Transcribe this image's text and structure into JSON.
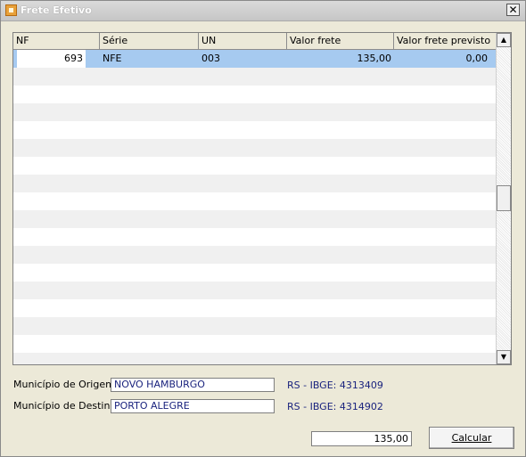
{
  "window": {
    "title": "Frete Efetivo",
    "close_symbol": "✕"
  },
  "grid": {
    "columns": [
      "NF",
      "Série",
      "UN",
      "Valor frete",
      "Valor frete previsto"
    ],
    "rows": [
      {
        "nf": "693",
        "serie": "NFE",
        "un": "003",
        "valor_frete": "135,00",
        "valor_previsto": "0,00"
      }
    ],
    "scroll_up": "▲",
    "scroll_down": "▼"
  },
  "origem": {
    "label": "Município de Origem",
    "value": "NOVO HAMBURGO",
    "ibge": "RS - IBGE: 4313409"
  },
  "destino": {
    "label": "Município de Destino",
    "value": "PORTO ALEGRE",
    "ibge": "RS - IBGE: 4314902"
  },
  "total": "135,00",
  "calcular": {
    "label": "Calcular",
    "shortcut_char": "C"
  }
}
